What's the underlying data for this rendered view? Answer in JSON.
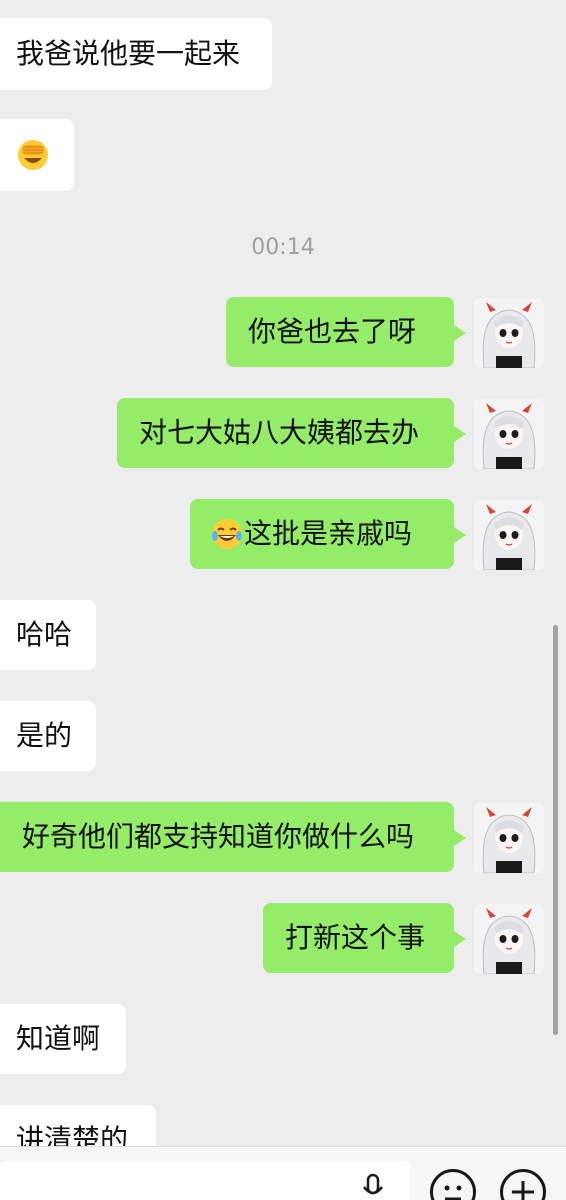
{
  "timestamp": "00:14",
  "messages": [
    {
      "side": "in",
      "text": "我爸说他要一起来"
    },
    {
      "side": "in",
      "emoji": "facepalm-emoji"
    },
    {
      "side": "out",
      "text": "你爸也去了呀"
    },
    {
      "side": "out",
      "text": "对七大姑八大姨都去办"
    },
    {
      "side": "out",
      "emoji": "tears-of-joy-emoji",
      "text": "这批是亲戚吗"
    },
    {
      "side": "in",
      "text": "哈哈"
    },
    {
      "side": "in",
      "text": "是的"
    },
    {
      "side": "out",
      "text": "好奇他们都支持知道你做什么吗"
    },
    {
      "side": "out",
      "text": "打新这个事"
    },
    {
      "side": "in",
      "text": "知道啊"
    },
    {
      "side": "in",
      "text": "讲清楚的"
    }
  ],
  "input_bar": {
    "voice_icon": "microphone-icon",
    "emoji_icon": "smiley-icon",
    "more_icon": "plus-icon"
  },
  "colors": {
    "background": "#ededed",
    "incoming_bubble": "#ffffff",
    "outgoing_bubble": "#95ec69",
    "timestamp": "#9e9e9e"
  }
}
